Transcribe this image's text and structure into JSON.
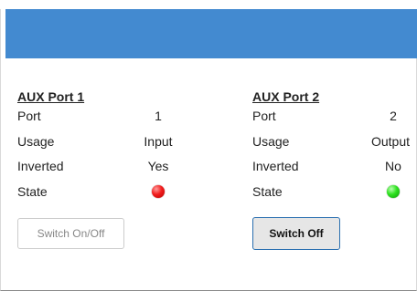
{
  "ports": [
    {
      "title": "AUX Port 1",
      "rows": {
        "port": {
          "label": "Port",
          "value": "1"
        },
        "usage": {
          "label": "Usage",
          "value": "Input"
        },
        "inverted": {
          "label": "Inverted",
          "value": "Yes"
        },
        "state": {
          "label": "State",
          "led_color": "#e00000"
        }
      },
      "button_label": "Switch On/Off"
    },
    {
      "title": "AUX Port 2",
      "rows": {
        "port": {
          "label": "Port",
          "value": "2"
        },
        "usage": {
          "label": "Usage",
          "value": "Output"
        },
        "inverted": {
          "label": "Inverted",
          "value": "No"
        },
        "state": {
          "label": "State",
          "led_color": "#20d010"
        }
      },
      "button_label": "Switch Off"
    }
  ]
}
